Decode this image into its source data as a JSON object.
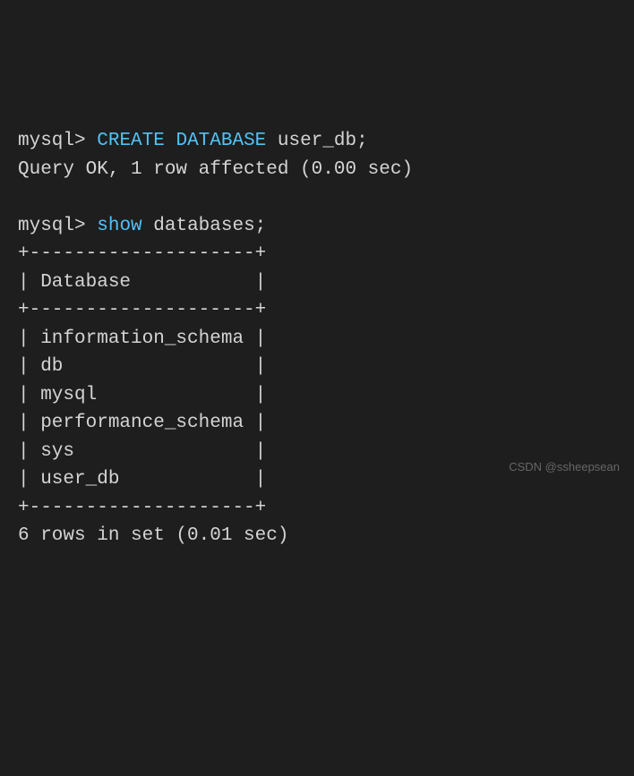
{
  "terminal": {
    "prompt": "mysql>",
    "cmd1_kw1": "CREATE",
    "cmd1_kw2": "DATABASE",
    "cmd1_arg": "user_db;",
    "response1": "Query OK, 1 row affected (0.00 sec)",
    "cmd2_kw1": "show",
    "cmd2_arg": "databases;",
    "table_border": "+--------------------+",
    "table_header": "| Database           |",
    "rows": [
      "| information_schema |",
      "| db                 |",
      "| mysql              |",
      "| performance_schema |",
      "| sys                |",
      "| user_db            |"
    ],
    "summary": "6 rows in set (0.01 sec)"
  },
  "watermark": {
    "main": "CSDN @ssheepsean",
    "faint": ""
  }
}
